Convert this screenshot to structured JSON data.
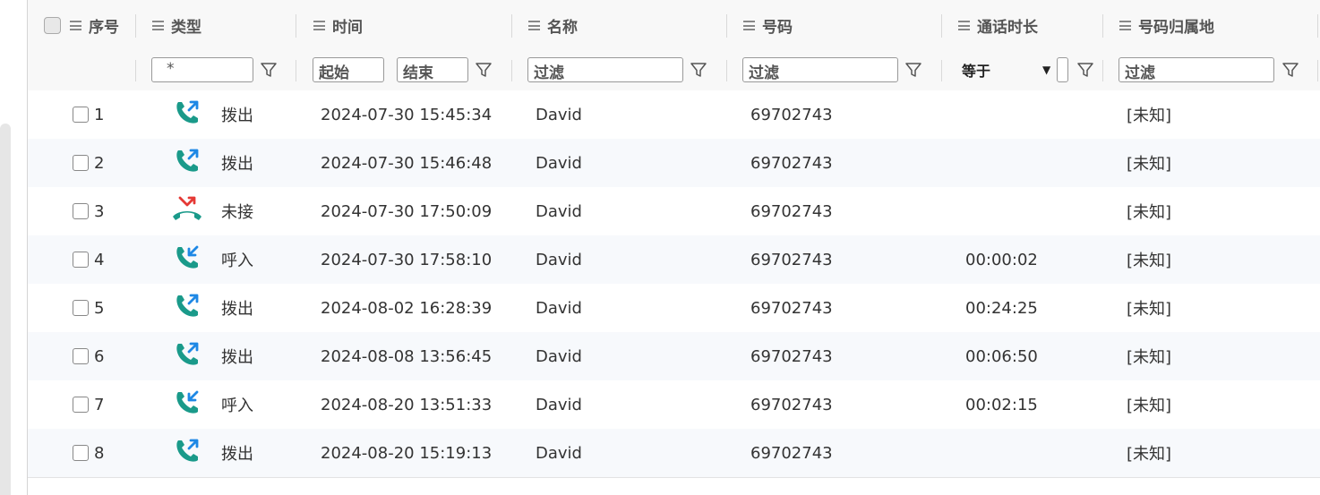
{
  "columns": {
    "seq": "序号",
    "type": "类型",
    "time": "时间",
    "name": "名称",
    "number": "号码",
    "duration": "通话时长",
    "location": "号码归属地"
  },
  "filters": {
    "type_value": "*",
    "time_start": "起始",
    "time_end": "结束",
    "name_placeholder": "过滤",
    "number_placeholder": "过滤",
    "duration_operator": "等于",
    "location_placeholder": "过滤"
  },
  "colors": {
    "outgoing": "#1a9a8a",
    "incoming": "#1a9a8a",
    "missed_handset": "#1a9a8a",
    "missed_arrow": "#e53935",
    "arrow_blue": "#1e88e5"
  },
  "rows": [
    {
      "seq": "1",
      "icon": "outgoing-call-icon",
      "type": "拨出",
      "time": "2024-07-30 15:45:34",
      "name": "David",
      "number": "69702743",
      "duration": "",
      "location": "[未知]"
    },
    {
      "seq": "2",
      "icon": "outgoing-call-icon",
      "type": "拨出",
      "time": "2024-07-30 15:46:48",
      "name": "David",
      "number": "69702743",
      "duration": "",
      "location": "[未知]"
    },
    {
      "seq": "3",
      "icon": "missed-call-icon",
      "type": "未接",
      "time": "2024-07-30 17:50:09",
      "name": "David",
      "number": "69702743",
      "duration": "",
      "location": "[未知]"
    },
    {
      "seq": "4",
      "icon": "incoming-call-icon",
      "type": "呼入",
      "time": "2024-07-30 17:58:10",
      "name": "David",
      "number": "69702743",
      "duration": "00:00:02",
      "location": "[未知]"
    },
    {
      "seq": "5",
      "icon": "outgoing-call-icon",
      "type": "拨出",
      "time": "2024-08-02 16:28:39",
      "name": "David",
      "number": "69702743",
      "duration": "00:24:25",
      "location": "[未知]"
    },
    {
      "seq": "6",
      "icon": "outgoing-call-icon",
      "type": "拨出",
      "time": "2024-08-08 13:56:45",
      "name": "David",
      "number": "69702743",
      "duration": "00:06:50",
      "location": "[未知]"
    },
    {
      "seq": "7",
      "icon": "incoming-call-icon",
      "type": "呼入",
      "time": "2024-08-20 13:51:33",
      "name": "David",
      "number": "69702743",
      "duration": "00:02:15",
      "location": "[未知]"
    },
    {
      "seq": "8",
      "icon": "outgoing-call-icon",
      "type": "拨出",
      "time": "2024-08-20 15:19:13",
      "name": "David",
      "number": "69702743",
      "duration": "",
      "location": "[未知]"
    }
  ]
}
